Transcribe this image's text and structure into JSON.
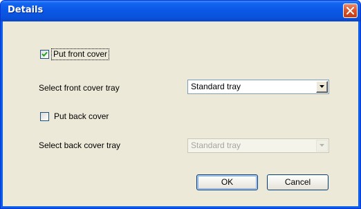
{
  "dialog": {
    "title": "Details",
    "close_icon": "close-icon"
  },
  "front_cover": {
    "checkbox_label": "Put front cover",
    "checked": true,
    "tray_label": "Select front cover tray",
    "tray_value": "Standard tray"
  },
  "back_cover": {
    "checkbox_label": "Put back cover",
    "checked": false,
    "tray_label": "Select back cover tray",
    "tray_value": "Standard tray"
  },
  "buttons": {
    "ok_label": "OK",
    "cancel_label": "Cancel"
  },
  "colors": {
    "titlebar": "#0a58e6",
    "client_background": "#ece9d8",
    "close_button": "#d8532b"
  }
}
